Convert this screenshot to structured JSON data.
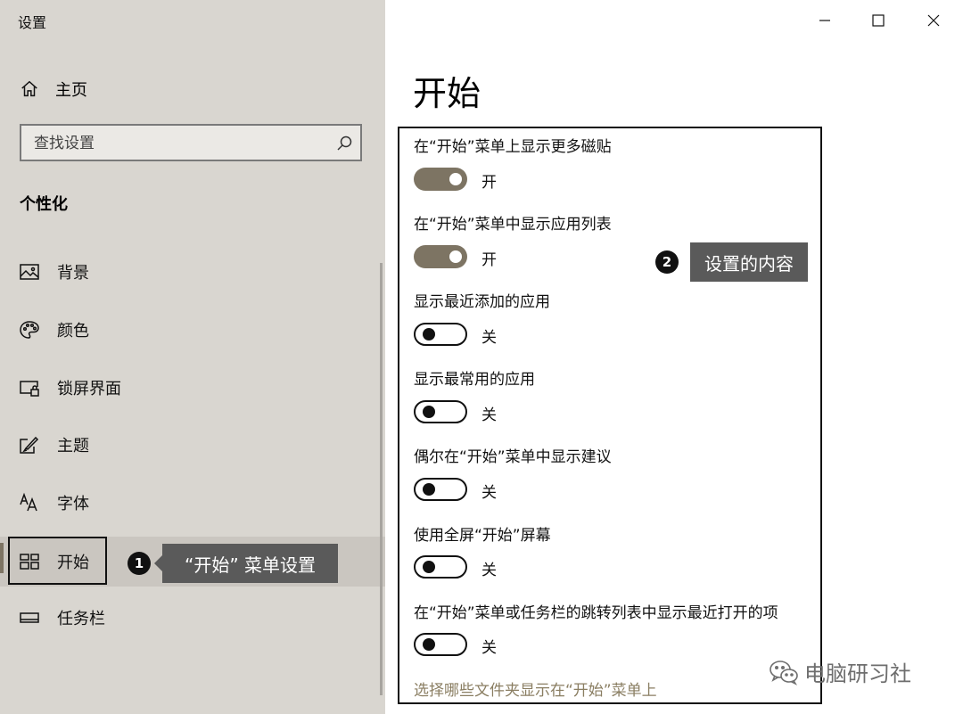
{
  "window": {
    "title": "设置"
  },
  "sidebar": {
    "home_label": "主页",
    "search_placeholder": "查找设置",
    "section_title": "个性化",
    "items": [
      {
        "label": "背景",
        "icon": "image-icon"
      },
      {
        "label": "颜色",
        "icon": "palette-icon"
      },
      {
        "label": "锁屏界面",
        "icon": "lock-screen-icon"
      },
      {
        "label": "主题",
        "icon": "theme-brush-icon"
      },
      {
        "label": "字体",
        "icon": "font-icon"
      },
      {
        "label": "开始",
        "icon": "start-tiles-icon",
        "selected": true
      },
      {
        "label": "任务栏",
        "icon": "taskbar-icon"
      }
    ]
  },
  "annotations": {
    "callout1": {
      "badge": "1",
      "text": "“开始” 菜单设置"
    },
    "callout2": {
      "badge": "2",
      "text": "设置的内容"
    }
  },
  "main": {
    "title": "开始",
    "settings": [
      {
        "label": "在“开始”菜单上显示更多磁贴",
        "state": "开",
        "on": true
      },
      {
        "label": "在“开始”菜单中显示应用列表",
        "state": "开",
        "on": true
      },
      {
        "label": "显示最近添加的应用",
        "state": "关",
        "on": false
      },
      {
        "label": "显示最常用的应用",
        "state": "关",
        "on": false
      },
      {
        "label": "偶尔在“开始”菜单中显示建议",
        "state": "关",
        "on": false
      },
      {
        "label": "使用全屏“开始”屏幕",
        "state": "关",
        "on": false
      },
      {
        "label": "在“开始”菜单或任务栏的跳转列表中显示最近打开的项",
        "state": "关",
        "on": false
      }
    ],
    "link": "选择哪些文件夹显示在“开始”菜单上"
  },
  "watermark": {
    "text": "电脑研习社"
  },
  "colors": {
    "toggle_on": "#7d7463",
    "sidebar_bg": "#d9d6d0",
    "link": "#8a7e62"
  }
}
